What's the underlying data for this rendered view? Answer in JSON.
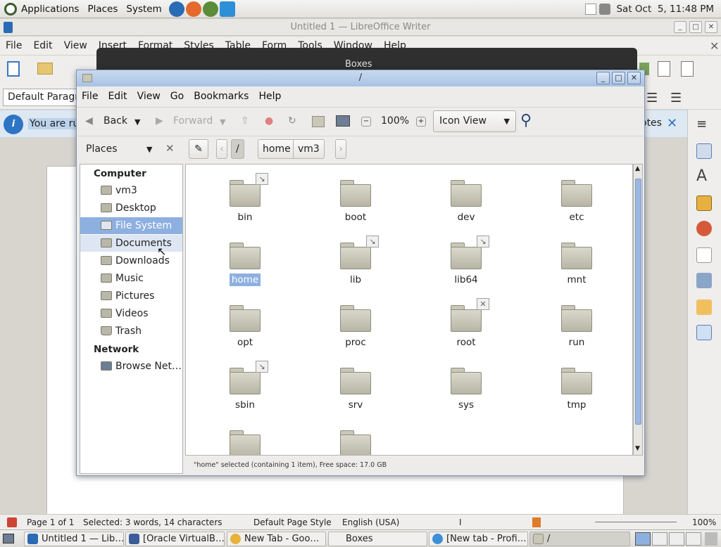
{
  "top_panel": {
    "menus": [
      "Applications",
      "Places",
      "System"
    ],
    "clock": "Sat Oct  5, 11:48 PM",
    "launcher_icons": [
      "dev-browser-icon",
      "firefox-icon",
      "chrome-dev-icon",
      "vscode-icon"
    ]
  },
  "writer": {
    "title": "Untitled 1 — LibreOffice Writer",
    "menu": [
      "File",
      "Edit",
      "View",
      "Insert",
      "Format",
      "Styles",
      "Table",
      "Form",
      "Tools",
      "Window",
      "Help"
    ],
    "paragraph_style": "Default Paragrap",
    "infobar_text": "You are run",
    "infobar_notes": "otes",
    "status": {
      "page": "Page 1 of 1",
      "selection": "Selected: 3 words, 14 characters",
      "page_style": "Default Page Style",
      "language": "English (USA)",
      "zoom": "100%"
    }
  },
  "boxes": {
    "title": "Boxes"
  },
  "file_manager": {
    "title": "/",
    "menu": [
      "File",
      "Edit",
      "View",
      "Go",
      "Bookmarks",
      "Help"
    ],
    "toolbar": {
      "back": "Back",
      "forward": "Forward",
      "zoom": "100%",
      "view_mode": "Icon View"
    },
    "location": {
      "places_label": "Places",
      "crumbs": [
        "/",
        "home",
        "vm3"
      ]
    },
    "places": {
      "computer_heading": "Computer",
      "computer_items": [
        "vm3",
        "Desktop",
        "File System",
        "Documents",
        "Downloads",
        "Music",
        "Pictures",
        "Videos",
        "Trash"
      ],
      "selected_item": "File System",
      "network_heading": "Network",
      "network_items": [
        "Browse Net…"
      ]
    },
    "folders": [
      {
        "name": "bin",
        "emblem": "link"
      },
      {
        "name": "boot",
        "emblem": ""
      },
      {
        "name": "dev",
        "emblem": ""
      },
      {
        "name": "etc",
        "emblem": ""
      },
      {
        "name": "home",
        "emblem": "",
        "selected": true
      },
      {
        "name": "lib",
        "emblem": "link"
      },
      {
        "name": "lib64",
        "emblem": "link"
      },
      {
        "name": "mnt",
        "emblem": ""
      },
      {
        "name": "opt",
        "emblem": ""
      },
      {
        "name": "proc",
        "emblem": ""
      },
      {
        "name": "root",
        "emblem": "locked"
      },
      {
        "name": "run",
        "emblem": ""
      },
      {
        "name": "sbin",
        "emblem": "link"
      },
      {
        "name": "srv",
        "emblem": ""
      },
      {
        "name": "sys",
        "emblem": ""
      },
      {
        "name": "tmp",
        "emblem": ""
      },
      {
        "name": "",
        "emblem": ""
      },
      {
        "name": "",
        "emblem": ""
      }
    ],
    "status": "\"home\" selected (containing 1 item), Free space: 17.0 GB"
  },
  "taskbar": {
    "tasks": [
      "Untitled 1 — Lib…",
      "[Oracle VirtualB…",
      "New Tab - Goo…",
      "Boxes",
      "[New tab - Profi…",
      "/"
    ]
  },
  "colors": {
    "selection": "#8eb0e0",
    "titlebar": "#a9c2e4",
    "folder": "#c9c8b8"
  }
}
